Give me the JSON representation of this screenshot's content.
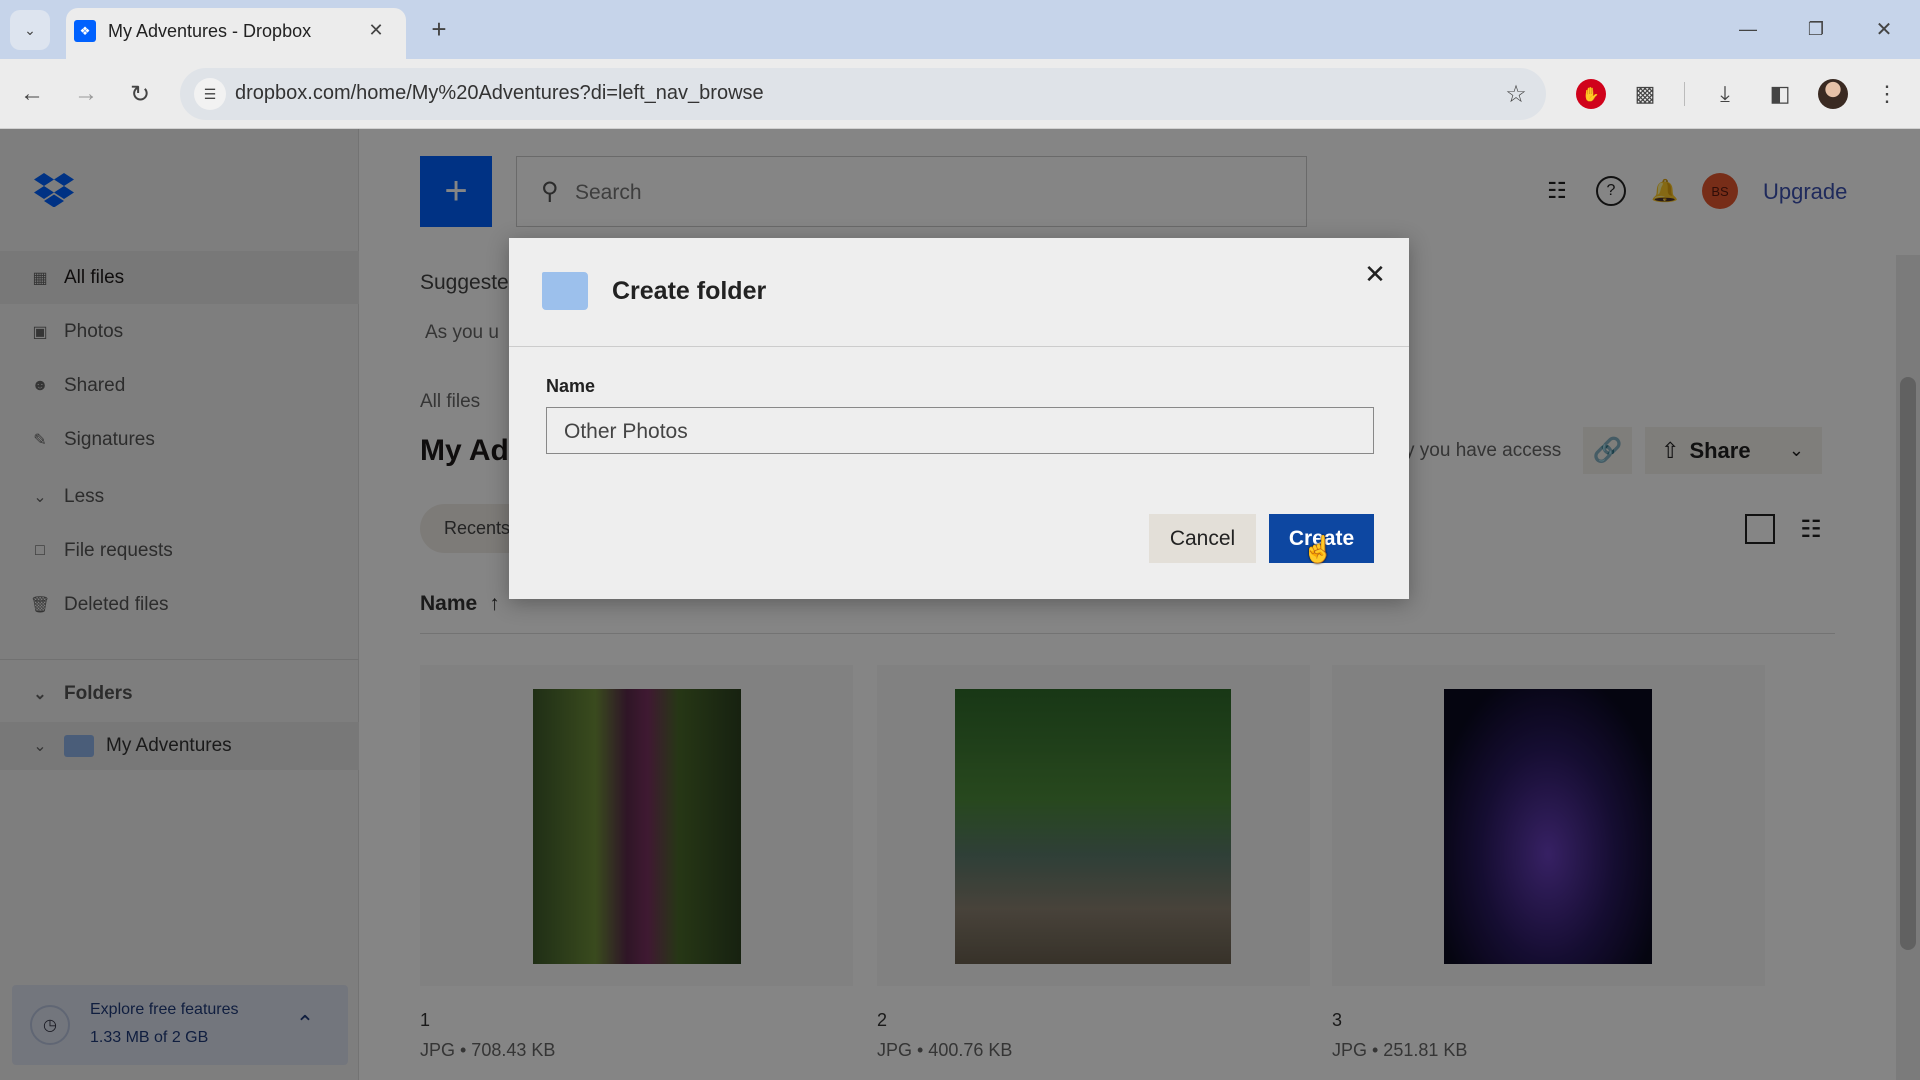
{
  "browser": {
    "tab_title": "My Adventures - Dropbox",
    "new_tab_icon": "plus-icon",
    "url": "dropbox.com/home/My%20Adventures?di=left_nav_browse",
    "window_controls": [
      "minimize-icon",
      "restore-icon",
      "close-icon"
    ],
    "toolbar_icons": [
      "bookmark-star-icon",
      "adblock-icon",
      "extensions-icon",
      "download-icon",
      "side-panel-icon",
      "profile-avatar",
      "menu-icon"
    ]
  },
  "sidebar": {
    "logo": "dropbox-logo",
    "items": [
      {
        "label": "All files",
        "icon": "all-files-icon",
        "active": true
      },
      {
        "label": "Photos",
        "icon": "photos-icon"
      },
      {
        "label": "Shared",
        "icon": "shared-icon"
      },
      {
        "label": "Signatures",
        "icon": "signature-icon"
      },
      {
        "label": "Less",
        "icon": "chevron-down-icon"
      },
      {
        "label": "File requests",
        "icon": "file-request-icon"
      },
      {
        "label": "Deleted files",
        "icon": "trash-icon"
      }
    ],
    "folders_label": "Folders",
    "folder_item": "My Adventures",
    "promo": {
      "title": "Explore free features",
      "usage": "1.33 MB of 2 GB"
    }
  },
  "header": {
    "search_placeholder": "Search",
    "avatar_initials": "BS",
    "upgrade": "Upgrade",
    "accent": "#0061fe"
  },
  "main": {
    "suggested": "Suggeste",
    "suggested_sub": "As you u",
    "breadcrumb": "All files",
    "title": "My Adv",
    "access_text": "y you have access",
    "share_label": "Share",
    "recents_chip": "Recents",
    "sort_column": "Name",
    "files": [
      {
        "name": "1",
        "meta": "JPG • 708.43 KB"
      },
      {
        "name": "2",
        "meta": "JPG • 400.76 KB"
      },
      {
        "name": "3",
        "meta": "JPG • 251.81 KB"
      }
    ]
  },
  "dialog": {
    "title": "Create folder",
    "name_label": "Name",
    "name_value": "Other Photos",
    "cancel": "Cancel",
    "create": "Create",
    "create_color": "#0d47a1"
  }
}
